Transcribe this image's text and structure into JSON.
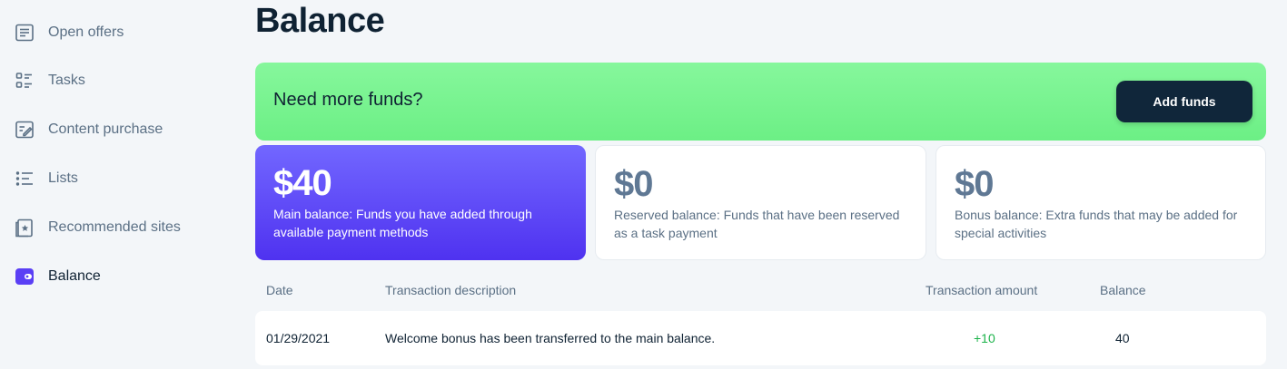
{
  "sidebar": {
    "items": [
      {
        "label": "Open offers",
        "icon": "document-list-icon"
      },
      {
        "label": "Tasks",
        "icon": "checklist-icon"
      },
      {
        "label": "Content purchase",
        "icon": "edit-document-icon"
      },
      {
        "label": "Lists",
        "icon": "list-icon"
      },
      {
        "label": "Recommended sites",
        "icon": "bookmark-star-icon"
      },
      {
        "label": "Balance",
        "icon": "wallet-icon",
        "active": true
      }
    ]
  },
  "main": {
    "title": "Balance",
    "banner": {
      "text": "Need more funds?",
      "button_label": "Add funds"
    },
    "cards": {
      "main": {
        "amount": "$40",
        "description": "Main balance: Funds you have added through available payment methods"
      },
      "reserved": {
        "amount": "$0",
        "description": "Reserved balance: Funds that have been reserved as a task payment"
      },
      "bonus": {
        "amount": "$0",
        "description": "Bonus balance: Extra funds that may be added for special activities"
      }
    },
    "table": {
      "headers": {
        "date": "Date",
        "description": "Transaction description",
        "amount": "Transaction amount",
        "balance": "Balance"
      },
      "rows": [
        {
          "date": "01/29/2021",
          "description": "Welcome bonus has been transferred to the main balance.",
          "amount": "+10",
          "balance": "40"
        }
      ]
    }
  },
  "colors": {
    "accent": "#5a3ff5",
    "banner_green": "#6cef85",
    "dark_button": "#10263a",
    "positive": "#1db34b",
    "muted_text": "#5b7085"
  }
}
